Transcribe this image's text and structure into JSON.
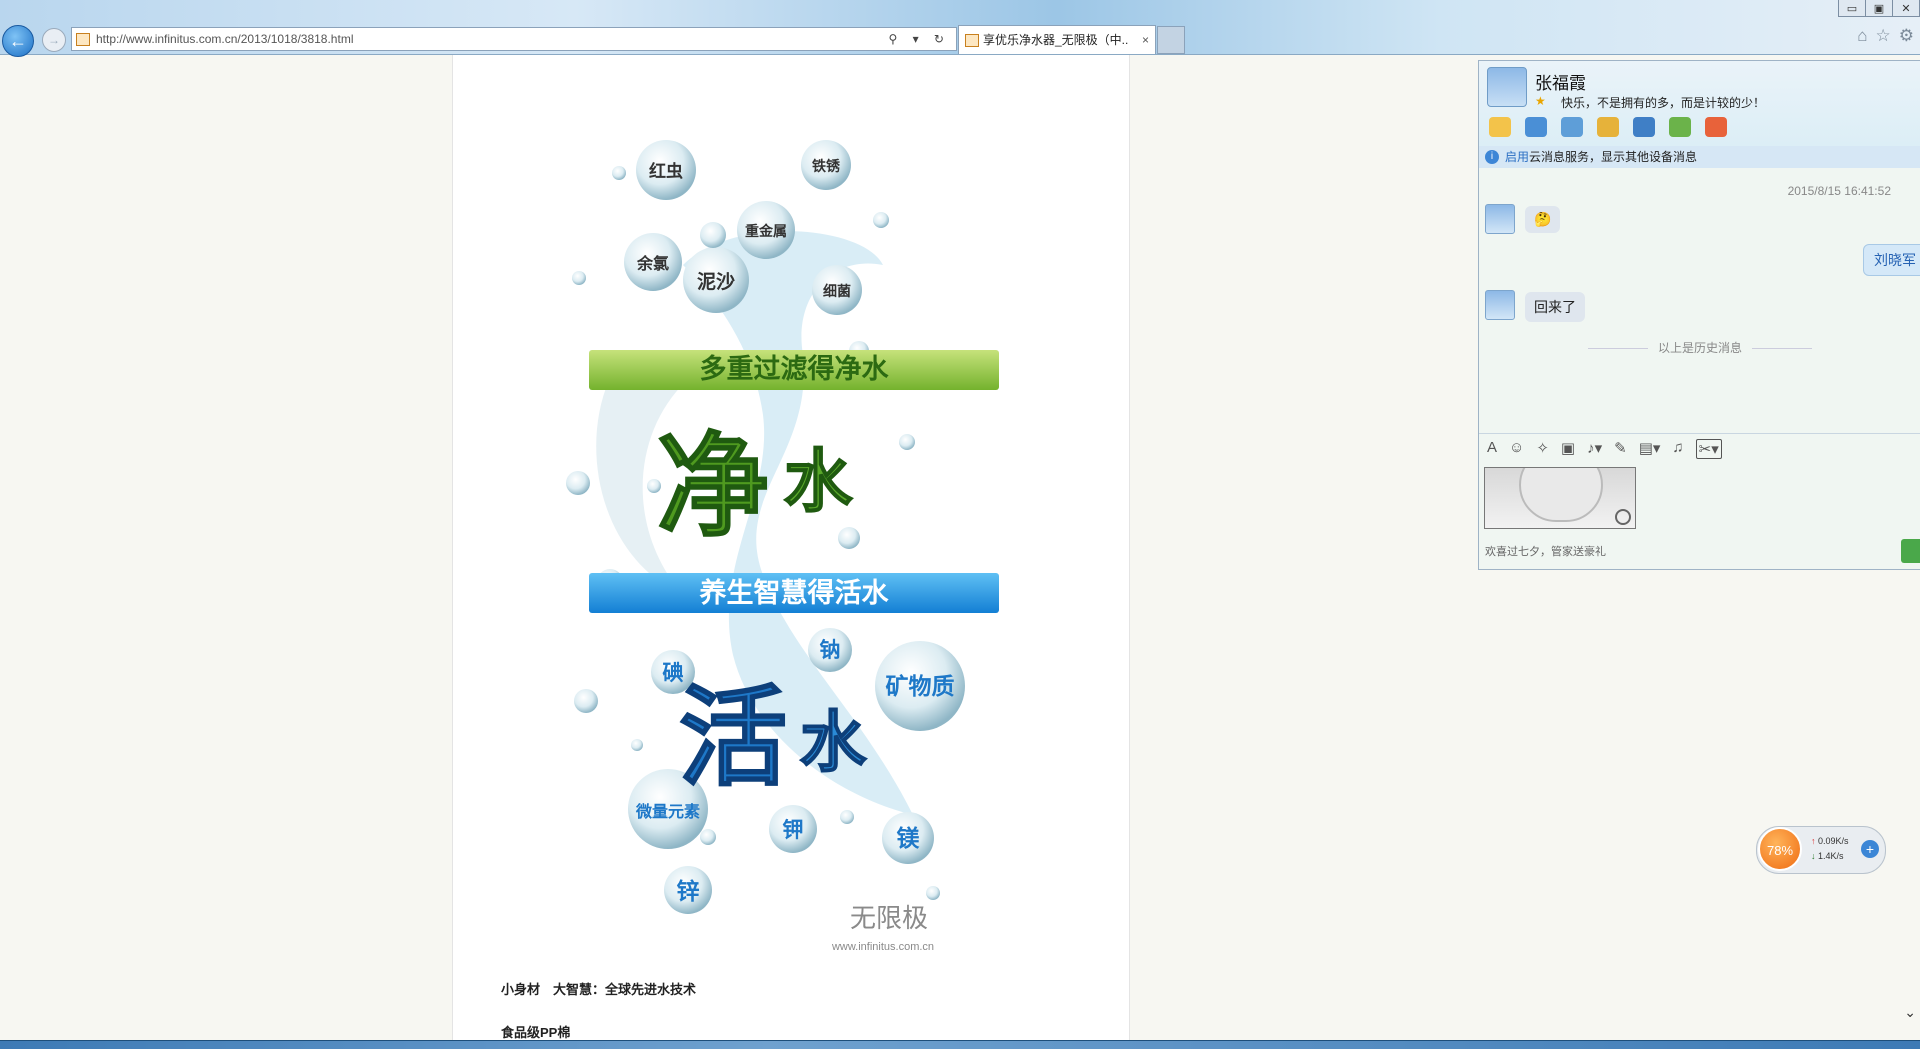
{
  "browser": {
    "url": "http://www.infinitus.com.cn/2013/1018/3818.html",
    "tab_title": "享优乐净水器_无限极（中...",
    "tab_close": "×",
    "window_buttons": [
      "▭",
      "▣",
      "✕"
    ],
    "address_tools": "⚲ ▾ ↻",
    "right_icons": [
      "⌂",
      "☆",
      "⚙"
    ]
  },
  "article": {
    "banner": {
      "impurities": [
        "红虫",
        "铁锈",
        "重金属",
        "余氯",
        "泥沙",
        "细菌"
      ],
      "band_top": "多重过滤得净水",
      "big_top": [
        "净",
        "水"
      ],
      "band_bottom": "养生智慧得活水",
      "big_bottom": [
        "活",
        "水"
      ],
      "minerals": [
        "钠",
        "碘",
        "矿物质",
        "微量元素",
        "钾",
        "镁",
        "锌"
      ],
      "brand_cn": "无限极",
      "brand_url": "www.infinitus.com.cn",
      "colors": {
        "green_band": "#8fc43c",
        "blue_band": "#1d8fe0",
        "green_text": "#4f9a1f",
        "blue_text": "#1e78c8"
      }
    },
    "caption1": "小身材　大智慧：全球先进水技术",
    "caption2": "食品级PP棉"
  },
  "chat": {
    "contact_name": "张福霞",
    "signature": "快乐，不是拥有的多，而是计较的少！",
    "notice_link": "启用",
    "notice_text": "云消息服务，显示其他设备消息",
    "timestamp": "2015/8/15 16:41:52",
    "messages": [
      {
        "side": "left",
        "text": "🤔"
      },
      {
        "side": "right",
        "text": "刘晓军"
      },
      {
        "side": "left",
        "text": "回来了"
      }
    ],
    "history_divider": "以上是历史消息",
    "footer_text": "欢喜过七夕，管家送豪礼"
  },
  "net_meter": {
    "percent": "78%",
    "upload": "0.09K/s",
    "download": "1.4K/s",
    "accent": "#ef6b12"
  }
}
